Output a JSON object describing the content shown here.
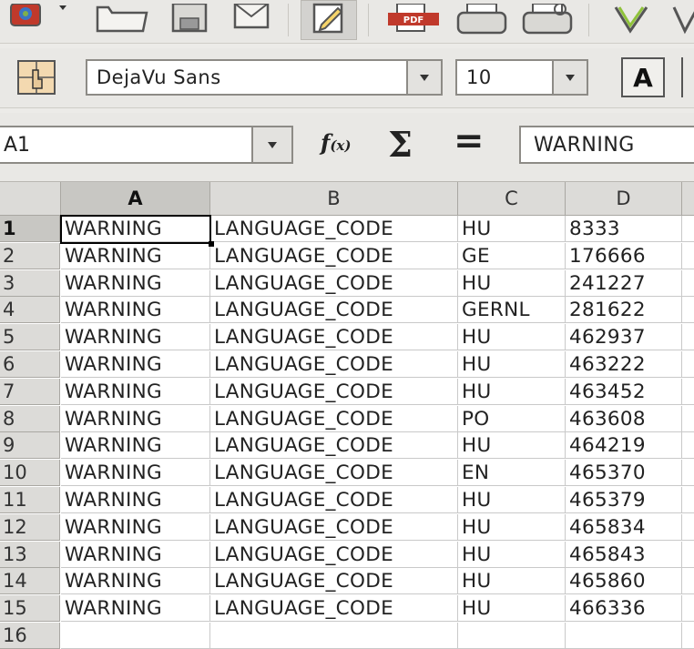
{
  "font_box": {
    "value": "DejaVu Sans"
  },
  "size_box": {
    "value": "10"
  },
  "bold_button": {
    "label": "A"
  },
  "name_box": {
    "value": "A1"
  },
  "formula": {
    "fx_label": "f",
    "fx_sub": "(x)",
    "sigma_label": "Σ",
    "equals_label": "=",
    "value": "WARNING"
  },
  "sheet": {
    "columns": [
      "A",
      "B",
      "C",
      "D"
    ],
    "active_column": "A",
    "rows": [
      {
        "n": "1",
        "a": "WARNING",
        "b": "LANGUAGE_CODE",
        "c": "HU",
        "d": "8333"
      },
      {
        "n": "2",
        "a": "WARNING",
        "b": "LANGUAGE_CODE",
        "c": "GE",
        "d": "176666"
      },
      {
        "n": "3",
        "a": "WARNING",
        "b": "LANGUAGE_CODE",
        "c": "HU",
        "d": "241227"
      },
      {
        "n": "4",
        "a": "WARNING",
        "b": "LANGUAGE_CODE",
        "c": "GERNL",
        "d": "281622"
      },
      {
        "n": "5",
        "a": "WARNING",
        "b": "LANGUAGE_CODE",
        "c": "HU",
        "d": "462937"
      },
      {
        "n": "6",
        "a": "WARNING",
        "b": "LANGUAGE_CODE",
        "c": "HU",
        "d": "463222"
      },
      {
        "n": "7",
        "a": "WARNING",
        "b": "LANGUAGE_CODE",
        "c": "HU",
        "d": "463452"
      },
      {
        "n": "8",
        "a": "WARNING",
        "b": "LANGUAGE_CODE",
        "c": "PO",
        "d": "463608"
      },
      {
        "n": "9",
        "a": "WARNING",
        "b": "LANGUAGE_CODE",
        "c": "HU",
        "d": "464219"
      },
      {
        "n": "10",
        "a": "WARNING",
        "b": "LANGUAGE_CODE",
        "c": "EN",
        "d": "465370"
      },
      {
        "n": "11",
        "a": "WARNING",
        "b": "LANGUAGE_CODE",
        "c": "HU",
        "d": "465379"
      },
      {
        "n": "12",
        "a": "WARNING",
        "b": "LANGUAGE_CODE",
        "c": "HU",
        "d": "465834"
      },
      {
        "n": "13",
        "a": "WARNING",
        "b": "LANGUAGE_CODE",
        "c": "HU",
        "d": "465843"
      },
      {
        "n": "14",
        "a": "WARNING",
        "b": "LANGUAGE_CODE",
        "c": "HU",
        "d": "465860"
      },
      {
        "n": "15",
        "a": "WARNING",
        "b": "LANGUAGE_CODE",
        "c": "HU",
        "d": "466336"
      },
      {
        "n": "16",
        "a": "",
        "b": "",
        "c": "",
        "d": ""
      }
    ]
  },
  "toolbar_icons": [
    "new-document-icon",
    "open-folder-icon",
    "save-icon",
    "email-icon",
    "edit-file-icon",
    "export-pdf-icon",
    "print-icon",
    "print-preview-icon",
    "spellcheck-icon",
    "autospellcheck-icon",
    "styles-icon",
    "bold-icon"
  ],
  "colors": {
    "accent": "#4a7ab5",
    "selection_border": "#000000",
    "header_bg": "#dcdbd8"
  }
}
